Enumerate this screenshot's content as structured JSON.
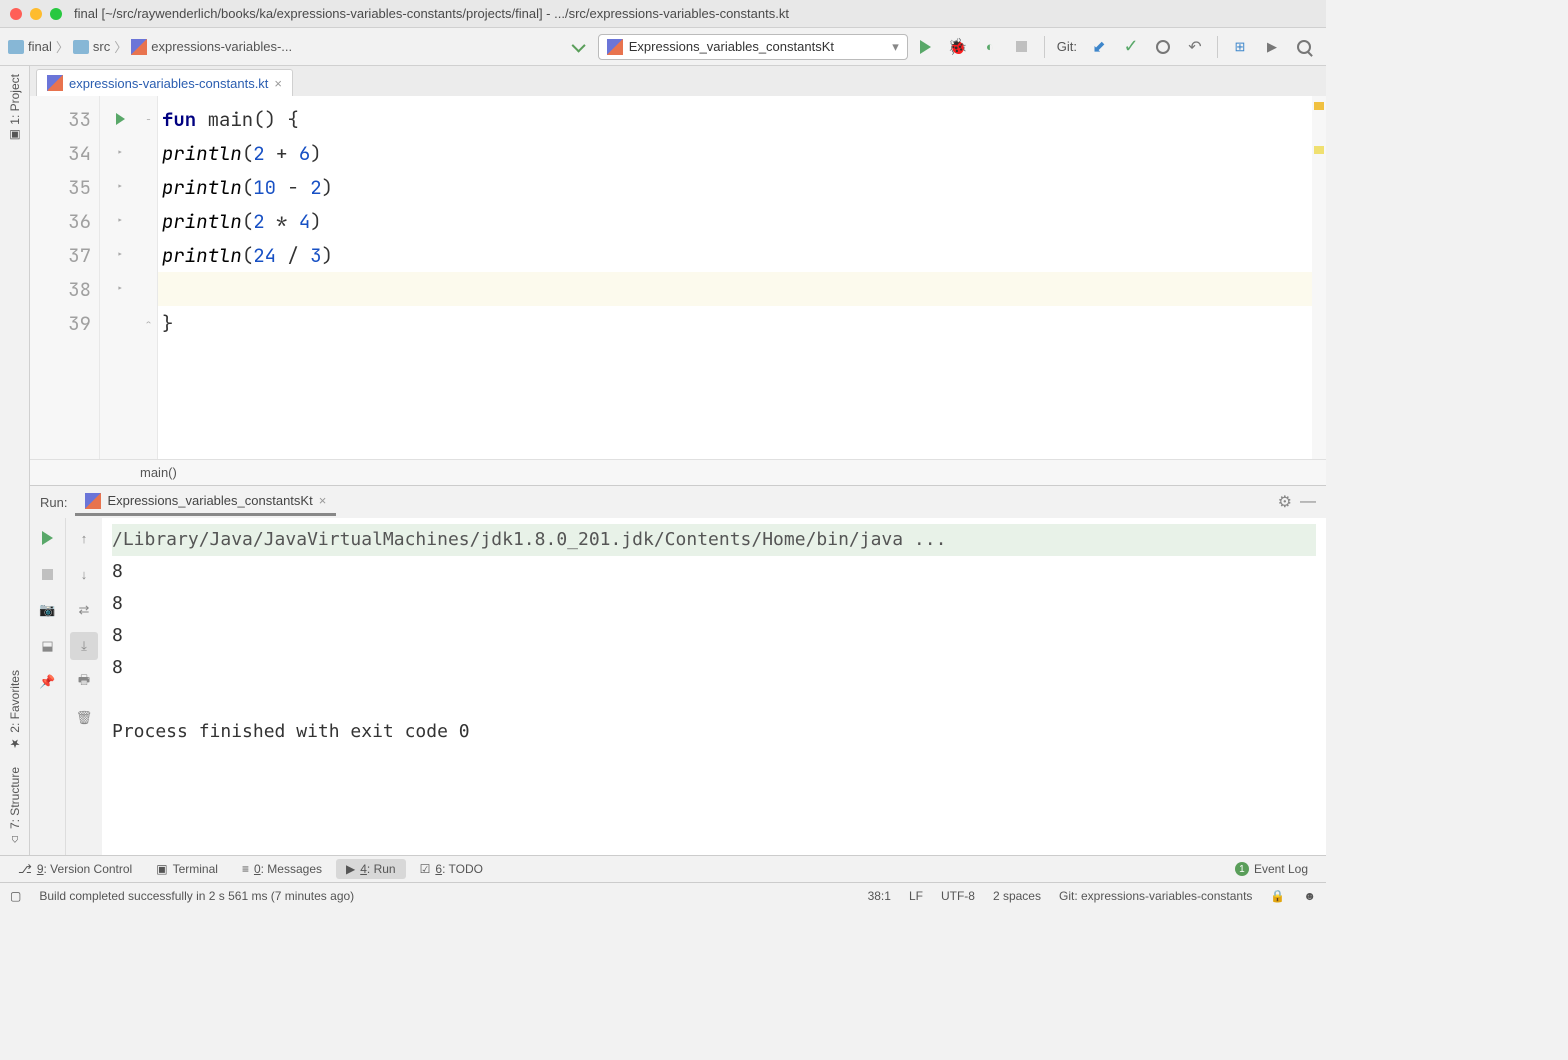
{
  "window_title": "final [~/src/raywenderlich/books/ka/expressions-variables-constants/projects/final] - .../src/expressions-variables-constants.kt",
  "breadcrumb": {
    "items": [
      "final",
      "src",
      "expressions-variables-..."
    ]
  },
  "run_config": "Expressions_variables_constantsKt",
  "git_label": "Git:",
  "editor_tab": "expressions-variables-constants.kt",
  "code": {
    "lines": [
      {
        "num": "33",
        "indent": "",
        "tokens": [
          {
            "t": "fun ",
            "c": "kw"
          },
          {
            "t": "main() {",
            "c": ""
          }
        ],
        "run": true,
        "fold": "−"
      },
      {
        "num": "34",
        "indent": "  ",
        "tokens": [
          {
            "t": "println",
            "c": "fn"
          },
          {
            "t": "(",
            "c": ""
          },
          {
            "t": "2",
            "c": "num"
          },
          {
            "t": " + ",
            "c": ""
          },
          {
            "t": "6",
            "c": "num"
          },
          {
            "t": ")",
            "c": ""
          }
        ],
        "bp": true
      },
      {
        "num": "35",
        "indent": "  ",
        "tokens": [
          {
            "t": "println",
            "c": "fn"
          },
          {
            "t": "(",
            "c": ""
          },
          {
            "t": "10",
            "c": "num"
          },
          {
            "t": " - ",
            "c": ""
          },
          {
            "t": "2",
            "c": "num"
          },
          {
            "t": ")",
            "c": ""
          }
        ],
        "bp": true
      },
      {
        "num": "36",
        "indent": "  ",
        "tokens": [
          {
            "t": "println",
            "c": "fn"
          },
          {
            "t": "(",
            "c": ""
          },
          {
            "t": "2",
            "c": "num"
          },
          {
            "t": " * ",
            "c": ""
          },
          {
            "t": "4",
            "c": "num"
          },
          {
            "t": ")",
            "c": ""
          }
        ],
        "bp": true
      },
      {
        "num": "37",
        "indent": "  ",
        "tokens": [
          {
            "t": "println",
            "c": "fn"
          },
          {
            "t": "(",
            "c": ""
          },
          {
            "t": "24",
            "c": "num"
          },
          {
            "t": " / ",
            "c": ""
          },
          {
            "t": "3",
            "c": "num"
          },
          {
            "t": ")",
            "c": ""
          }
        ],
        "bp": true
      },
      {
        "num": "38",
        "indent": "  ",
        "tokens": [],
        "hl": true,
        "bp": true
      },
      {
        "num": "39",
        "indent": "",
        "tokens": [
          {
            "t": "}",
            "c": ""
          }
        ],
        "fold": "⌃"
      }
    ]
  },
  "context_info": "main()",
  "sidebar": {
    "project": "1: Project",
    "favorites": "2: Favorites",
    "structure": "7: Structure"
  },
  "run_panel": {
    "label": "Run:",
    "tab": "Expressions_variables_constantsKt",
    "output": [
      {
        "text": "/Library/Java/JavaVirtualMachines/jdk1.8.0_201.jdk/Contents/Home/bin/java ...",
        "cls": "console-cmd"
      },
      {
        "text": "8",
        "cls": ""
      },
      {
        "text": "8",
        "cls": ""
      },
      {
        "text": "8",
        "cls": ""
      },
      {
        "text": "8",
        "cls": ""
      },
      {
        "text": "",
        "cls": ""
      },
      {
        "text": "Process finished with exit code 0",
        "cls": "console-exit"
      }
    ]
  },
  "bottom_tabs": {
    "vcs": "9: Version Control",
    "terminal": "Terminal",
    "messages": "0: Messages",
    "run": "4: Run",
    "todo": "6: TODO",
    "event_log": "Event Log",
    "event_count": "1"
  },
  "status": {
    "msg": "Build completed successfully in 2 s 561 ms (7 minutes ago)",
    "pos": "38:1",
    "lf": "LF",
    "enc": "UTF-8",
    "indent": "2 spaces",
    "git": "Git: expressions-variables-constants"
  }
}
